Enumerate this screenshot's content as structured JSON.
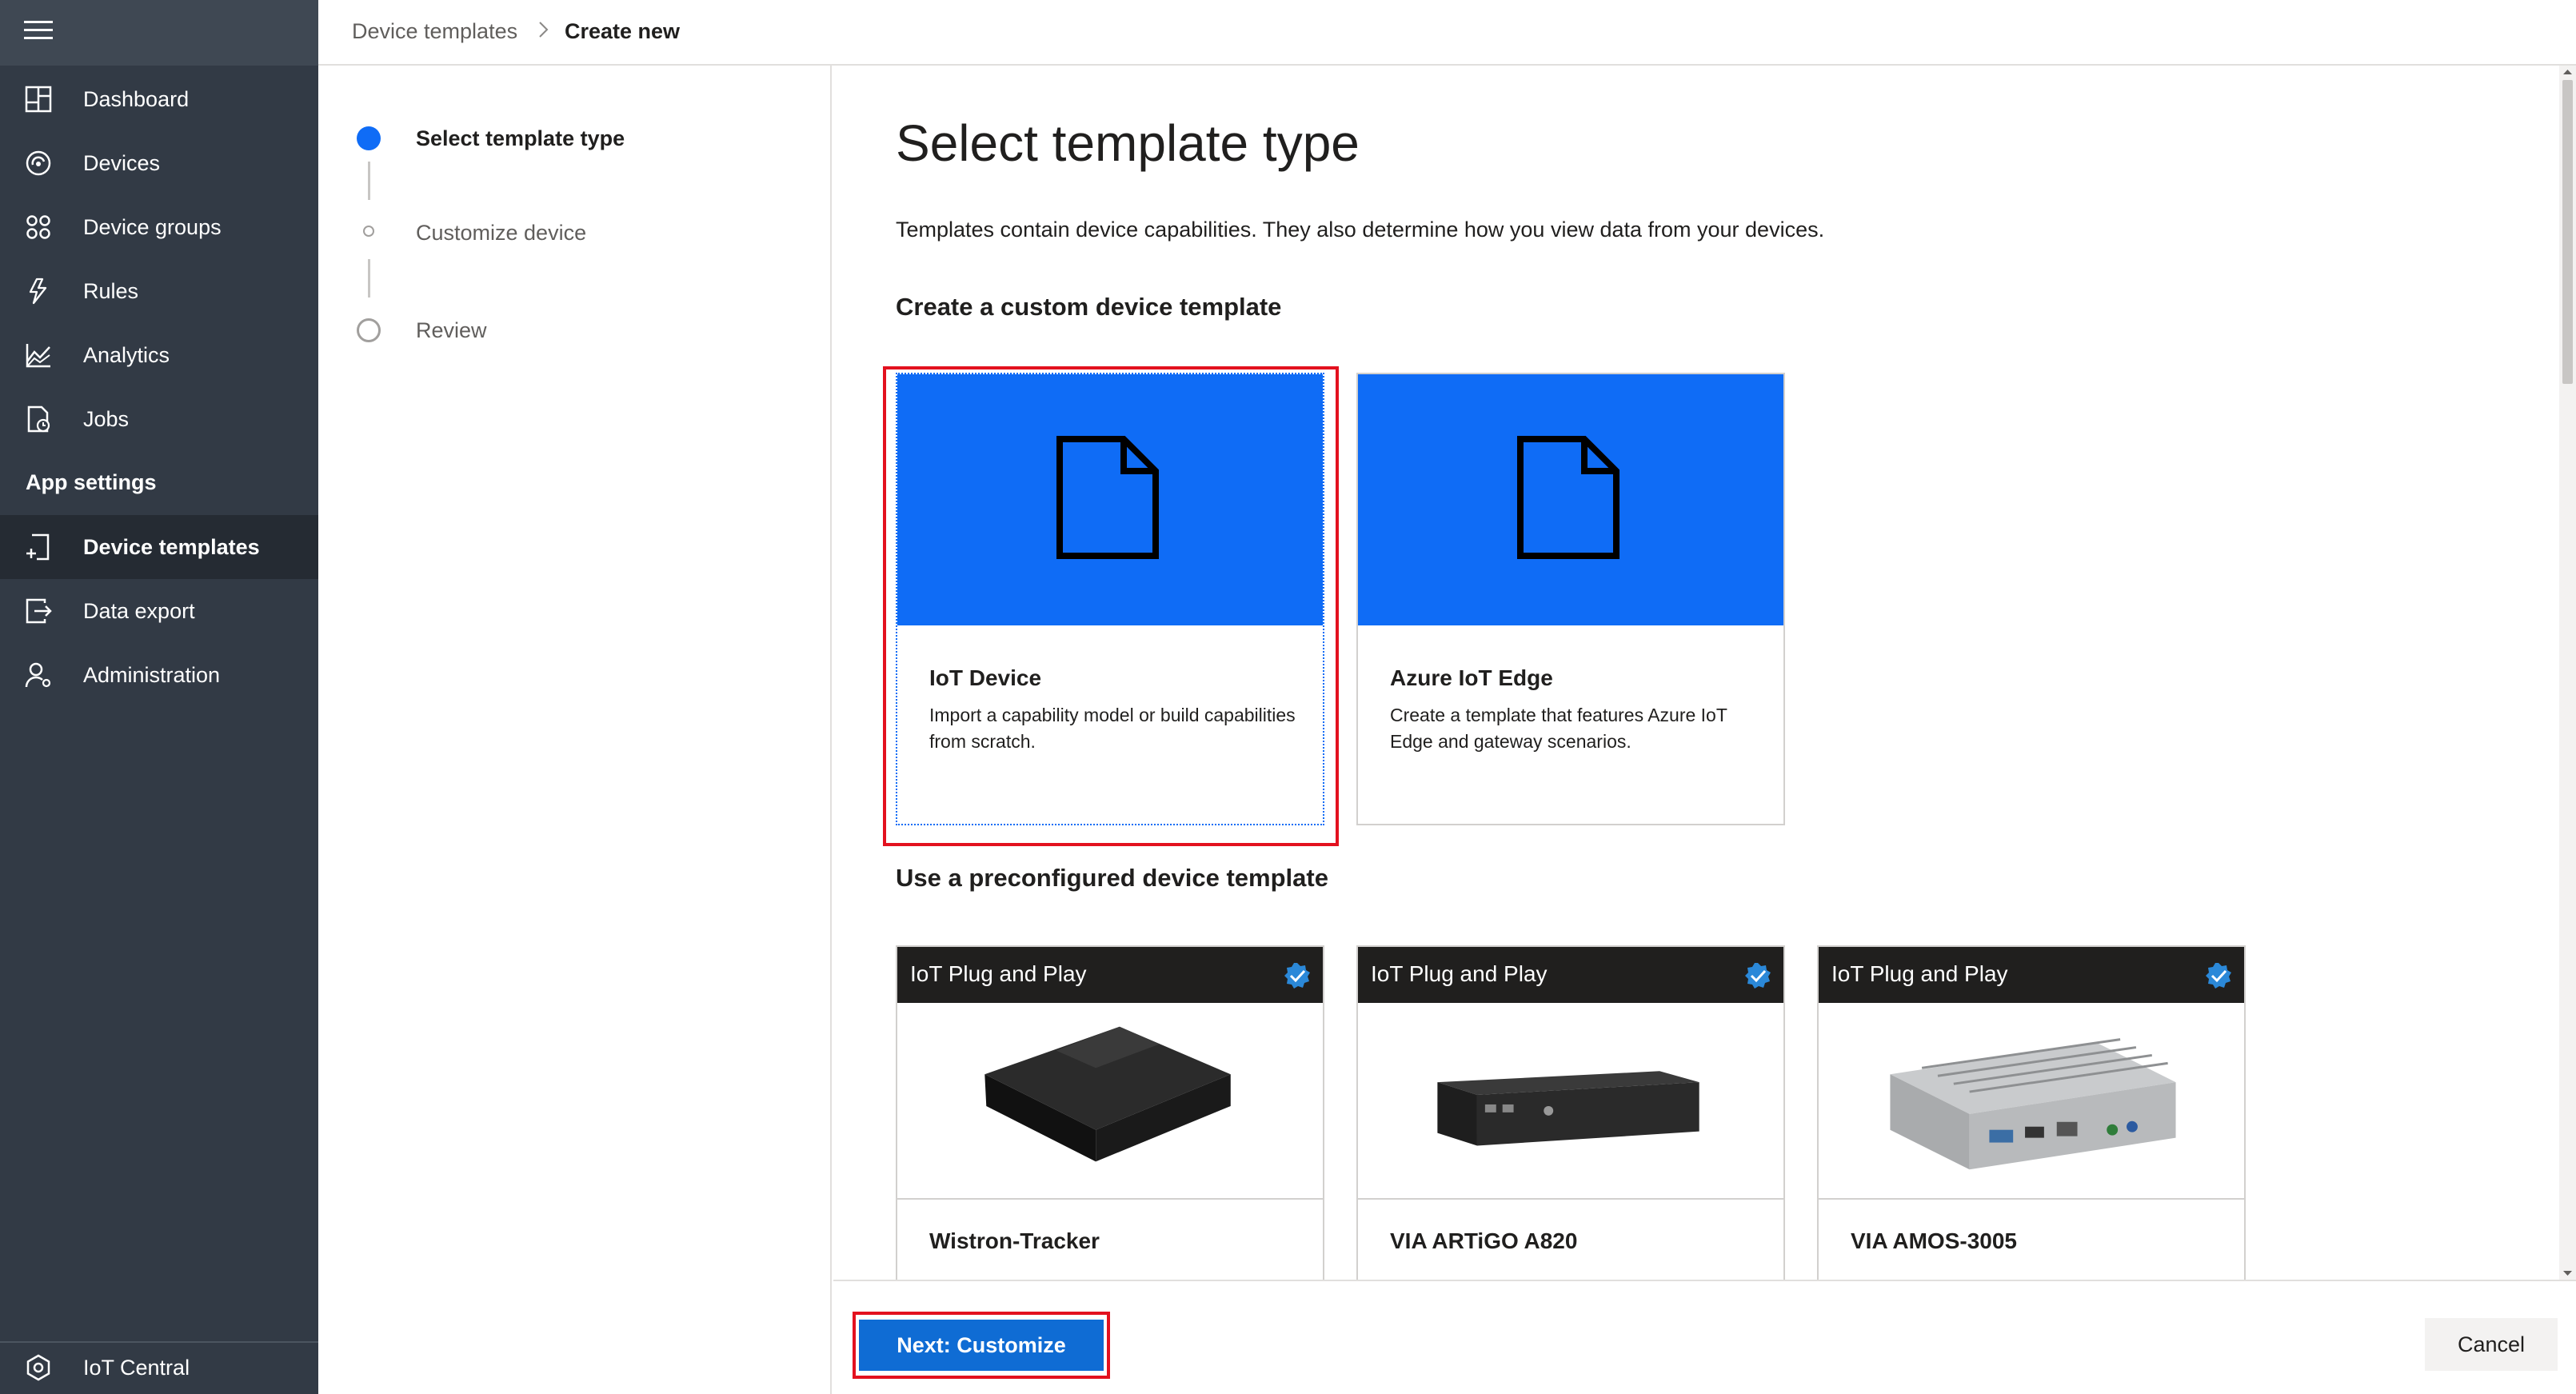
{
  "nav": {
    "items": [
      {
        "label": "Dashboard",
        "icon": "dashboard-icon"
      },
      {
        "label": "Devices",
        "icon": "devices-icon"
      },
      {
        "label": "Device groups",
        "icon": "device-groups-icon"
      },
      {
        "label": "Rules",
        "icon": "rules-icon"
      },
      {
        "label": "Analytics",
        "icon": "analytics-icon"
      },
      {
        "label": "Jobs",
        "icon": "jobs-icon"
      }
    ],
    "section_label": "App settings",
    "settings_items": [
      {
        "label": "Device templates",
        "icon": "device-templates-icon",
        "active": true
      },
      {
        "label": "Data export",
        "icon": "data-export-icon"
      },
      {
        "label": "Administration",
        "icon": "administration-icon"
      }
    ],
    "footer_label": "IoT Central",
    "footer_icon": "iot-central-icon"
  },
  "breadcrumb": {
    "parent": "Device templates",
    "current": "Create new"
  },
  "steps": [
    {
      "label": "Select template type",
      "state": "active"
    },
    {
      "label": "Customize device",
      "state": "pending"
    },
    {
      "label": "Review",
      "state": "pending"
    }
  ],
  "main": {
    "title": "Select template type",
    "description": "Templates contain device capabilities. They also determine how you view data from your devices.",
    "custom_heading": "Create a custom device template",
    "custom_cards": [
      {
        "title": "IoT Device",
        "description": "Import a capability model or build capabilities from scratch.",
        "selected": true
      },
      {
        "title": "Azure IoT Edge",
        "description": "Create a template that features Azure IoT Edge and gateway scenarios.",
        "selected": false
      }
    ],
    "preconfigured_heading": "Use a preconfigured device template",
    "preconfigured_cards": [
      {
        "header": "IoT Plug and Play",
        "title": "Wistron-Tracker"
      },
      {
        "header": "IoT Plug and Play",
        "title": "VIA ARTiGO A820"
      },
      {
        "header": "IoT Plug and Play",
        "title": "VIA AMOS-3005"
      }
    ]
  },
  "footer": {
    "next_label": "Next: Customize",
    "cancel_label": "Cancel"
  },
  "colors": {
    "nav_bg": "#323a45",
    "accent": "#0f6cf6",
    "primary_button": "#0f6cd4",
    "highlight": "#e3111f"
  }
}
